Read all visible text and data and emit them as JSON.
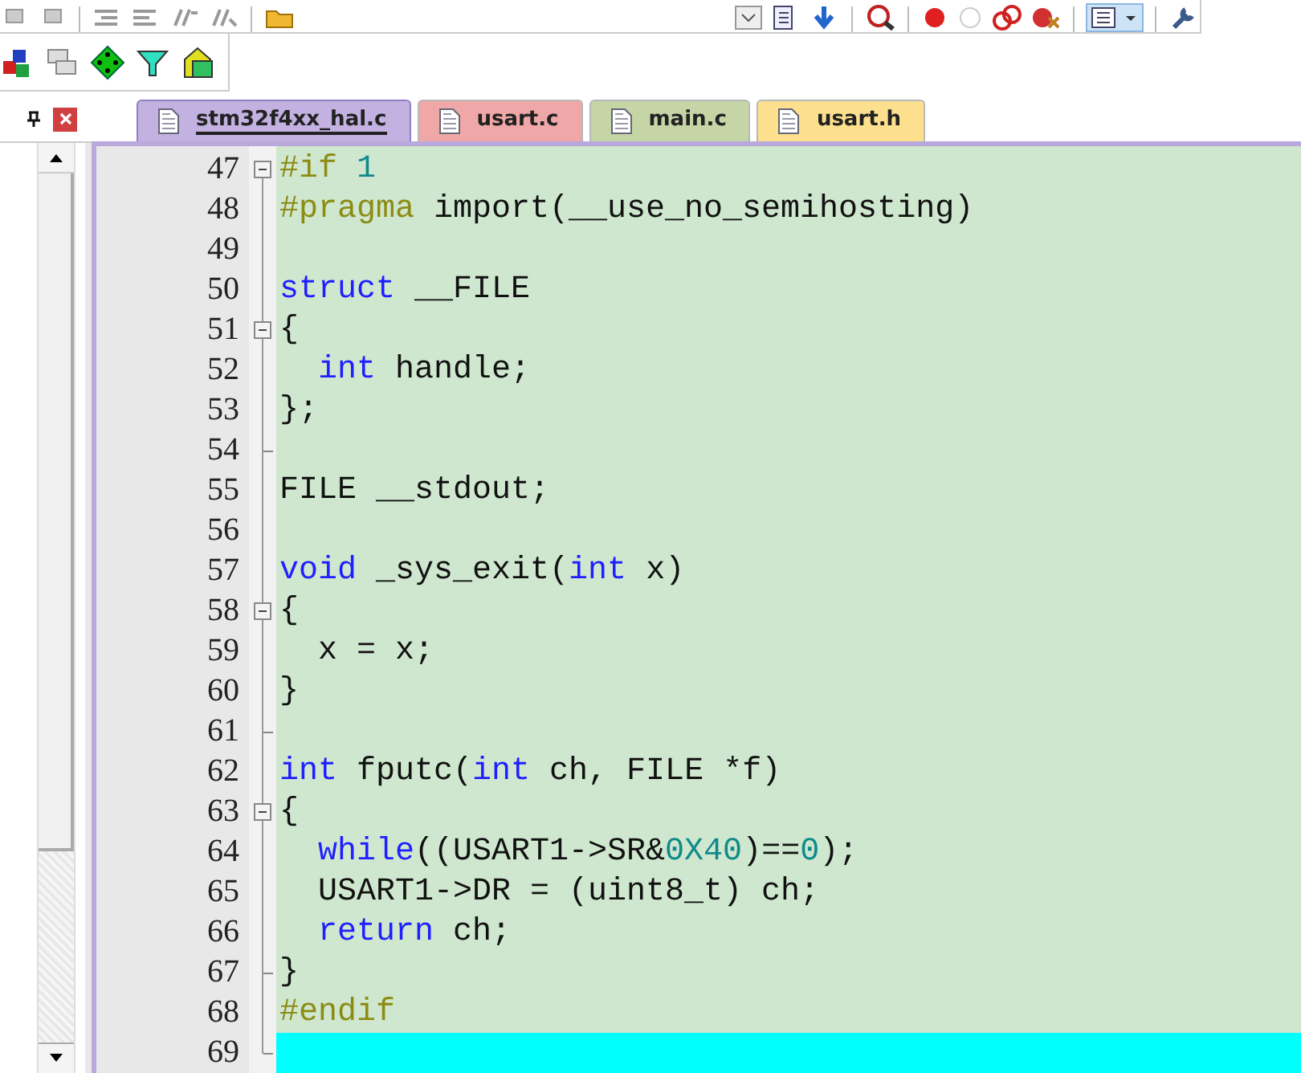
{
  "tabs": [
    {
      "label": "stm32f4xx_hal.c",
      "color": "#c3b1e1",
      "selected": true
    },
    {
      "label": "usart.c",
      "color": "#f0a7a7",
      "selected": false
    },
    {
      "label": "main.c",
      "color": "#c5d5a5",
      "selected": false
    },
    {
      "label": "usart.h",
      "color": "#fde08e",
      "selected": false
    }
  ],
  "editor": {
    "lines": [
      {
        "number": "47",
        "fold_box": true,
        "fold_end": false,
        "current": false,
        "tokens": [
          {
            "kind": "pp",
            "text": "#if"
          },
          {
            "kind": "num",
            "text": " 1"
          }
        ]
      },
      {
        "number": "48",
        "fold_box": false,
        "fold_end": false,
        "current": false,
        "tokens": [
          {
            "kind": "pp",
            "text": "#pragma"
          },
          {
            "kind": "plain",
            "text": " import(__use_no_semihosting)"
          }
        ]
      },
      {
        "number": "49",
        "fold_box": false,
        "fold_end": false,
        "current": false
      },
      {
        "number": "50",
        "fold_box": false,
        "fold_end": false,
        "current": false,
        "tokens": [
          {
            "kind": "kw",
            "text": "struct"
          },
          {
            "kind": "plain",
            "text": " __FILE"
          }
        ]
      },
      {
        "number": "51",
        "fold_box": true,
        "fold_end": false,
        "current": false,
        "tokens": [
          {
            "kind": "plain",
            "text": "{"
          }
        ]
      },
      {
        "number": "52",
        "fold_box": false,
        "fold_end": false,
        "current": false,
        "tokens": [
          {
            "kind": "kw",
            "text": "  int"
          },
          {
            "kind": "plain",
            "text": " handle;"
          }
        ]
      },
      {
        "number": "53",
        "fold_box": false,
        "fold_end": false,
        "current": false,
        "tokens": [
          {
            "kind": "plain",
            "text": "};"
          }
        ]
      },
      {
        "number": "54",
        "fold_box": false,
        "fold_end": true,
        "current": false
      },
      {
        "number": "55",
        "fold_box": false,
        "fold_end": false,
        "current": false,
        "tokens": [
          {
            "kind": "plain",
            "text": "FILE __stdout;"
          }
        ]
      },
      {
        "number": "56",
        "fold_box": false,
        "fold_end": false,
        "current": false
      },
      {
        "number": "57",
        "fold_box": false,
        "fold_end": false,
        "current": false,
        "tokens": [
          {
            "kind": "kw",
            "text": "void"
          },
          {
            "kind": "plain",
            "text": " _sys_exit("
          },
          {
            "kind": "kw",
            "text": "int"
          },
          {
            "kind": "plain",
            "text": " x)"
          }
        ]
      },
      {
        "number": "58",
        "fold_box": true,
        "fold_end": false,
        "current": false,
        "tokens": [
          {
            "kind": "plain",
            "text": "{"
          }
        ]
      },
      {
        "number": "59",
        "fold_box": false,
        "fold_end": false,
        "current": false,
        "tokens": [
          {
            "kind": "plain",
            "text": "  x = x;"
          }
        ]
      },
      {
        "number": "60",
        "fold_box": false,
        "fold_end": false,
        "current": false,
        "tokens": [
          {
            "kind": "plain",
            "text": "}"
          }
        ]
      },
      {
        "number": "61",
        "fold_box": false,
        "fold_end": true,
        "current": false
      },
      {
        "number": "62",
        "fold_box": false,
        "fold_end": false,
        "current": false,
        "tokens": [
          {
            "kind": "kw",
            "text": "int"
          },
          {
            "kind": "plain",
            "text": " fputc("
          },
          {
            "kind": "kw",
            "text": "int"
          },
          {
            "kind": "plain",
            "text": " ch, FILE *f)"
          }
        ]
      },
      {
        "number": "63",
        "fold_box": true,
        "fold_end": false,
        "current": false,
        "tokens": [
          {
            "kind": "plain",
            "text": "{"
          }
        ]
      },
      {
        "number": "64",
        "fold_box": false,
        "fold_end": false,
        "current": false,
        "tokens": [
          {
            "kind": "kw",
            "text": "  while"
          },
          {
            "kind": "plain",
            "text": "((USART1->SR&"
          },
          {
            "kind": "num",
            "text": "0X40"
          },
          {
            "kind": "plain",
            "text": ")=="
          },
          {
            "kind": "num",
            "text": "0"
          },
          {
            "kind": "plain",
            "text": ");"
          }
        ]
      },
      {
        "number": "65",
        "fold_box": false,
        "fold_end": false,
        "current": false,
        "tokens": [
          {
            "kind": "plain",
            "text": "  USART1->DR = (uint8_t) ch;"
          }
        ]
      },
      {
        "number": "66",
        "fold_box": false,
        "fold_end": false,
        "current": false,
        "tokens": [
          {
            "kind": "kw",
            "text": "  return"
          },
          {
            "kind": "plain",
            "text": " ch;"
          }
        ]
      },
      {
        "number": "67",
        "fold_box": false,
        "fold_end": true,
        "current": false,
        "tokens": [
          {
            "kind": "plain",
            "text": "}"
          }
        ]
      },
      {
        "number": "68",
        "fold_box": false,
        "fold_end": false,
        "current": false,
        "tokens": [
          {
            "kind": "pp",
            "text": "#endif"
          }
        ]
      },
      {
        "number": "69",
        "fold_box": false,
        "fold_end": true,
        "current": true
      }
    ]
  }
}
